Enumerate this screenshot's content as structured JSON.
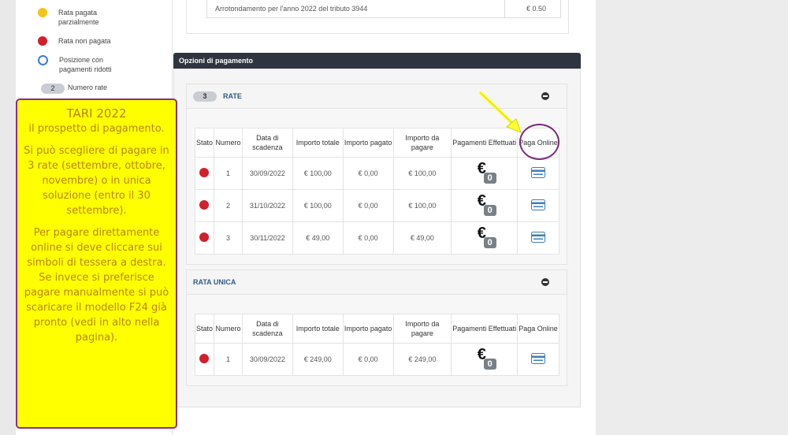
{
  "legend": {
    "partial": "Rata pagata parzialmente",
    "unpaid": "Rata non pagata",
    "reduced": "Posizione con pagamenti ridotti",
    "num_pill": "2",
    "num_label": "Numero rate",
    "colors": {
      "partial": "#f7c21a",
      "unpaid": "#d0202a",
      "reduced": "#3a7bd5"
    }
  },
  "rounding": {
    "label": "Arrotondamento per l'anno 2022 del tributo 3944",
    "value": "€ 0.50"
  },
  "section_title": "Opzioni di pagamento",
  "rate_panel": {
    "pill": "3",
    "title": "RATE",
    "headers": [
      "Stato",
      "Numero",
      "Data di scadenza",
      "Importo totale",
      "Importo pagato",
      "Importo da pagare",
      "Pagamenti Effettuati",
      "Paga Online"
    ],
    "rows": [
      {
        "numero": "1",
        "data": "30/09/2022",
        "totale": "€ 100,00",
        "pagato": "€ 0,00",
        "da_pagare": "€ 100,00",
        "effettuati": "0"
      },
      {
        "numero": "2",
        "data": "31/10/2022",
        "totale": "€ 100,00",
        "pagato": "€ 0,00",
        "da_pagare": "€ 100,00",
        "effettuati": "0"
      },
      {
        "numero": "3",
        "data": "30/11/2022",
        "totale": "€ 49,00",
        "pagato": "€ 0,00",
        "da_pagare": "€ 49,00",
        "effettuati": "0"
      }
    ]
  },
  "unica_panel": {
    "title": "RATA UNICA",
    "headers": [
      "Stato",
      "Numero",
      "Data di scadenza",
      "Importo totale",
      "Importo pagato",
      "Importo da pagare",
      "Pagamenti Effettuati",
      "Paga Online"
    ],
    "rows": [
      {
        "numero": "1",
        "data": "30/09/2022",
        "totale": "€ 249,00",
        "pagato": "€ 0,00",
        "da_pagare": "€ 249,00",
        "effettuati": "0"
      }
    ]
  },
  "euro_symbol": "€",
  "note": {
    "title": "TARI   2022",
    "line1": "il prospetto di pagamento.",
    "para2": "Si può scegliere di pagare in 3 rate (settembre, ottobre, novembre)  o in unica soluzione (entro il 30 settembre).",
    "para3": "Per pagare direttamente online si deve cliccare sui simboli di tessera a destra.",
    "para4": "Se invece si preferisce pagare manualmente si può scaricare il modello F24 già pronto (vedi in alto nella pagina)."
  }
}
